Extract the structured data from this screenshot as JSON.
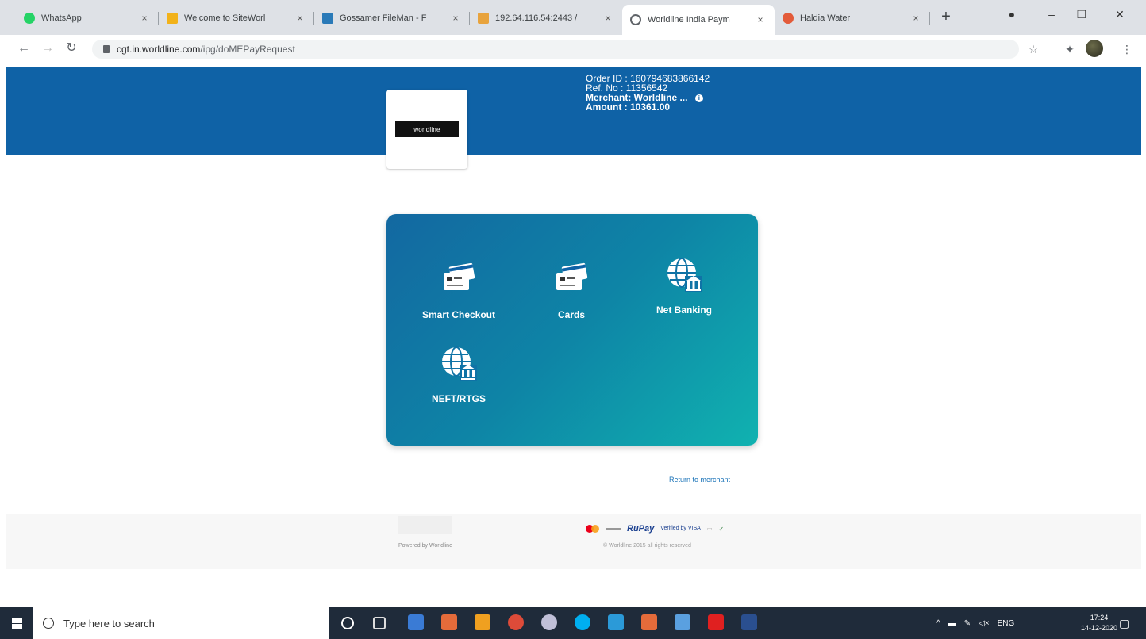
{
  "browser": {
    "tabs": [
      {
        "title": "WhatsApp",
        "close": "×"
      },
      {
        "title": "Welcome to SiteWorl",
        "close": "×"
      },
      {
        "title": "Gossamer FileMan - F",
        "close": "×"
      },
      {
        "title": "192.64.116.54:2443 /",
        "close": "×"
      },
      {
        "title": "Worldline India Paym",
        "close": "×"
      },
      {
        "title": "Haldia Water",
        "close": "×"
      }
    ],
    "new_tab": "+",
    "url_host": "cgt.in.worldline.com",
    "url_path": "/ipg/doMEPayRequest"
  },
  "header": {
    "logo_text": "worldline",
    "order_id_label": "Order ID",
    "order_id_value": ": 160794683866142",
    "ref_label": "Ref. No",
    "ref_value": ": 11356542",
    "merchant_label": "Merchant",
    "merchant_value": ": Worldline ...",
    "amount_label": "Amount",
    "amount_value": ": 10361.00"
  },
  "payment_options": [
    {
      "label": "Smart Checkout",
      "icon": "card-icon"
    },
    {
      "label": "Cards",
      "icon": "card-icon"
    },
    {
      "label": "Net Banking",
      "icon": "globe-bank-icon"
    },
    {
      "label": "NEFT/RTGS",
      "icon": "globe-bank-icon"
    }
  ],
  "return_link": "Return to merchant",
  "footer": {
    "powered_by": "Powered by Worldline",
    "copyright": "© Worldline 2015 all rights reserved",
    "rupay": "RuPay",
    "visa": "Verified by VISA"
  },
  "taskbar": {
    "search_placeholder": "Type here to search",
    "lang": "ENG",
    "time": "17:24",
    "date": "14-12-2020"
  },
  "colors": {
    "banner": "#0f62a6",
    "panel_start": "#1368a1",
    "panel_end": "#10b2b0"
  }
}
